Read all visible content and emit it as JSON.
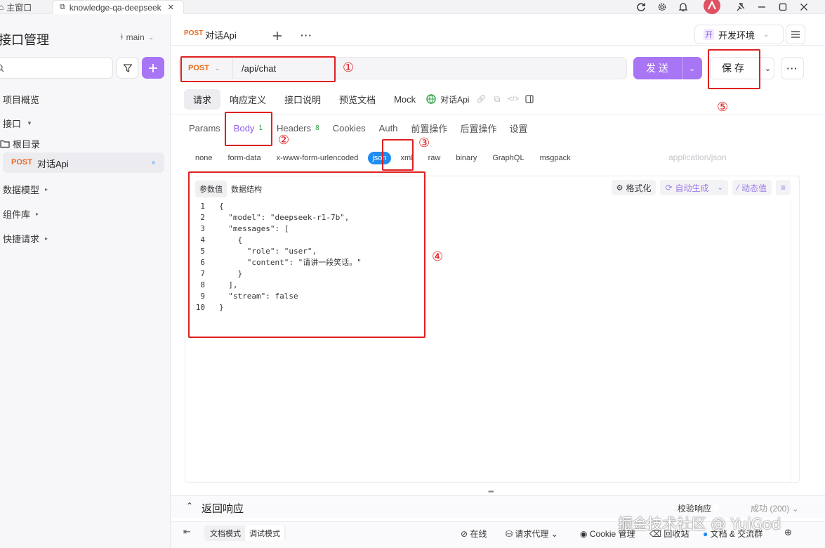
{
  "titlebar": {
    "tab_main": "主窗口",
    "tab_project": "knowledge-qa-deepseek",
    "close": "✕"
  },
  "sidebar": {
    "title": "接口管理",
    "branch": "main",
    "nav": {
      "overview": "项目概览",
      "interfaces": "接口",
      "root": "根目录",
      "api_method": "POST",
      "api_name": "对话Api",
      "models": "数据模型",
      "components": "组件库",
      "quick": "快捷请求"
    }
  },
  "header": {
    "tab_method": "POST",
    "tab_name": "对话Api",
    "env": "开发环境",
    "env_icon": "开"
  },
  "request": {
    "method": "POST",
    "url": "/api/chat",
    "send": "发 送",
    "save": "保 存"
  },
  "subtabs": [
    "请求",
    "响应定义",
    "接口说明",
    "预览文档",
    "Mock"
  ],
  "api_label": "对话Api",
  "param_tabs": [
    {
      "label": "Params",
      "count": ""
    },
    {
      "label": "Body",
      "count": "1"
    },
    {
      "label": "Headers",
      "count": "8"
    },
    {
      "label": "Cookies",
      "count": ""
    },
    {
      "label": "Auth",
      "count": ""
    },
    {
      "label": "前置操作",
      "count": ""
    },
    {
      "label": "后置操作",
      "count": ""
    },
    {
      "label": "设置",
      "count": ""
    }
  ],
  "body_types": [
    "none",
    "form-data",
    "x-www-form-urlencoded",
    "json",
    "xml",
    "raw",
    "binary",
    "GraphQL",
    "msgpack"
  ],
  "content_type": "application/json",
  "editor": {
    "tab_params": "参数值",
    "tab_schema": "数据结构",
    "format": "格式化",
    "autogen": "自动生成",
    "dynamic": "动态值"
  },
  "code": [
    {
      "n": "1",
      "t": "{"
    },
    {
      "n": "2",
      "t": "  \"model\": \"deepseek-r1-7b\","
    },
    {
      "n": "3",
      "t": "  \"messages\": ["
    },
    {
      "n": "4",
      "t": "    {"
    },
    {
      "n": "5",
      "t": "      \"role\": \"user\","
    },
    {
      "n": "6",
      "t": "      \"content\": \"请讲一段笑话。\""
    },
    {
      "n": "7",
      "t": "    }"
    },
    {
      "n": "8",
      "t": "  ],"
    },
    {
      "n": "9",
      "t": "  \"stream\": false"
    },
    {
      "n": "10",
      "t": "}"
    }
  ],
  "response": {
    "title": "返回响应",
    "validate": "校验响应",
    "status": "成功 (200)"
  },
  "statusbar": {
    "doc_mode": "文档模式",
    "debug_mode": "调试模式",
    "online": "在线",
    "proxy": "请求代理",
    "cookie": "Cookie 管理",
    "recycle": "回收站",
    "docs": "文档 & 交流群"
  },
  "annotations": [
    "①",
    "②",
    "③",
    "④",
    "⑤"
  ],
  "watermark": "掘金技术社区 @ YuiGod",
  "colors": {
    "accent": "#a875f5",
    "post": "#e8691b",
    "annotation": "#e02020",
    "json_pill": "#1f8cf1"
  }
}
